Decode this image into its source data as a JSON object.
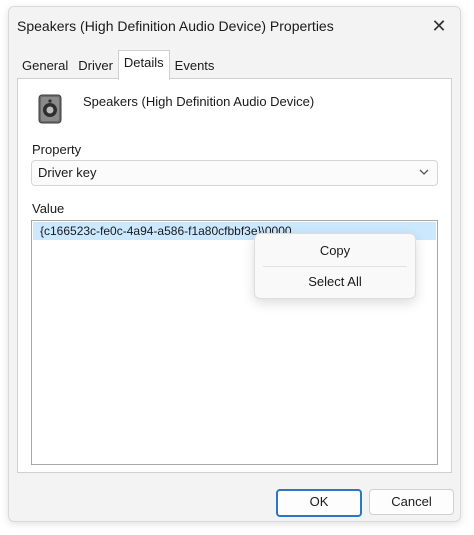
{
  "window": {
    "title": "Speakers (High Definition Audio Device) Properties",
    "close_glyph": "✕"
  },
  "tabs": [
    {
      "label": "General"
    },
    {
      "label": "Driver"
    },
    {
      "label": "Details"
    },
    {
      "label": "Events"
    }
  ],
  "active_tab": "Details",
  "device": {
    "icon": "speaker-icon",
    "name": "Speakers (High Definition Audio Device)"
  },
  "property": {
    "label": "Property",
    "selected": "Driver key"
  },
  "value": {
    "label": "Value",
    "items": [
      "{c166523c-fe0c-4a94-a586-f1a80cfbbf3e}\\0000"
    ]
  },
  "context_menu": {
    "items": [
      {
        "label": "Copy"
      },
      {
        "label": "Select All"
      }
    ]
  },
  "buttons": {
    "ok": "OK",
    "cancel": "Cancel"
  },
  "colors": {
    "selection": "#cce8ff",
    "accent": "#2b77c7"
  }
}
